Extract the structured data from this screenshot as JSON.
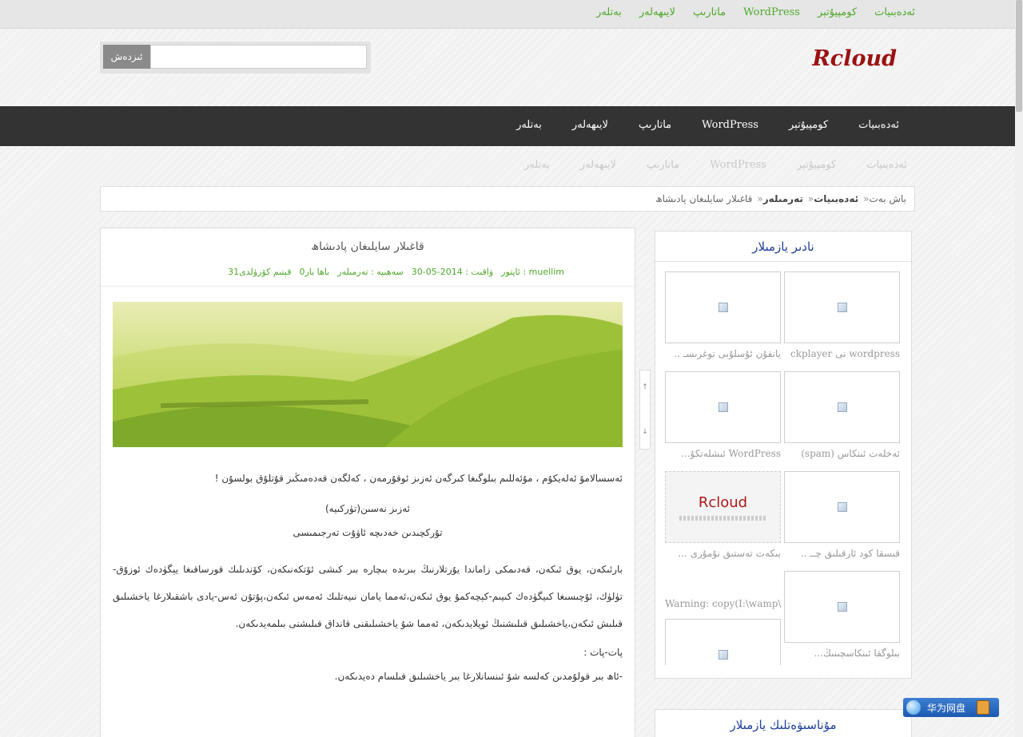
{
  "top_links": [
    "ئەدەبىيات",
    "كومپيۇتېر",
    "WordPress",
    "ماتارىپ",
    "لايىھەلەر",
    "بەتلەر"
  ],
  "logo": "Rcloud",
  "search": {
    "button": "ئىزدەش"
  },
  "main_nav": [
    "ئەدەبىيات",
    "كومپيۇتېر",
    "WordPress",
    "ماتارىپ",
    "لايىھەلەر",
    "بەتلەر"
  ],
  "ghost_nav": [
    "ئەدەبىيات",
    "كومپيۇتېر",
    "WordPress",
    "ماتارىپ",
    "لايىھەلەر",
    "بەتلەر"
  ],
  "breadcrumb": {
    "home": "باش بەت",
    "sep": "»",
    "cat": "ئەدەبىيات",
    "sub": "تەرمىلەر",
    "current": "قاغىلار سايلىغان پادىشاھ"
  },
  "post": {
    "title": "قاغىلار سايلىغان پادىشاھ",
    "meta": {
      "author": "ئاپتور : muellim",
      "time": "ۋاقىت : 2014-05-30",
      "category": "سەھىپە : تەرمىلەر",
      "comments": "0باھا بار",
      "views": "31قېتىم كۆرۈلدى"
    },
    "greeting": "ئەسسالامۇ ئەلەيكۇم ، مۇئەللىم بىلوگىغا كىرگەن ئەزىز ئوقۇرمەن ، كەلگەن قەدەمىڭىز قۇتلۇق بولسۇن !",
    "subtitle1": "ئەزىز نەسىن(تۈركىيە)",
    "subtitle2": "تۇركچىدىن خەدىچە ئاۋۇت تەرجىمىسى",
    "body": "بارئىكەن، يوق ئىكەن، قەدىمكى زاماندا يۇرتلارنىڭ بىرىدە بىچارە بىر كىشى ئۆتكەنىكەن، كۆندىلىك قورساقىغا يېگۈدەك ئوزۇق-تۈلۈك، ئۇچىسىغا كىيگۈدەك كىيىم-كېچەكمۇ يوق ئىكەن،ئەمما يامان نىيەتلىك ئەمەس ئىكەن،پۇتۇن ئەس-يادى باشقىلارغا ياخشىلىق قىلىش ئىكەن،ياخشىلىق قىلىشنىڭ ئويلايدىكەن، ئەمما شۇ ياخشىلىقنى قانداق قىلىشنى بىلمەيدىكەن.",
    "pat": "پات-پات :",
    "pat_line": "-ئاھ بىر قولۇمدىن كەلسە شۇ ئىنسانلارغا بىر ياخشىلىق قىلسام دەيدىكەن."
  },
  "widget": {
    "title": "نادىر يازمىلار",
    "items": [
      {
        "caption": "wordpress نى ckplayer"
      },
      {
        "caption": "يانفۇن ئۇسلۇبى توغرىسـ .."
      },
      {
        "caption": "ئەخلەت ئىنكاس (spam)"
      },
      {
        "caption": "WordPress ئىشلەتكۇ..."
      },
      {
        "caption": "بىكەت تەستىق نۇمۇرى ..."
      },
      {
        "caption": "قىسقا كود ئارقىلىق چــ .."
      },
      {
        "caption": "بىلوگقا ئىنكاسچىنىڭ..."
      },
      {
        "caption": "Warning: copy(I:\\wamp\\v"
      },
      {
        "caption": ""
      }
    ],
    "rcloud_logo": "Rcloud"
  },
  "widget2": {
    "title": "مۇناسىۋەتلىك يازمىلار"
  },
  "float": {
    "label": "华为网盘"
  }
}
